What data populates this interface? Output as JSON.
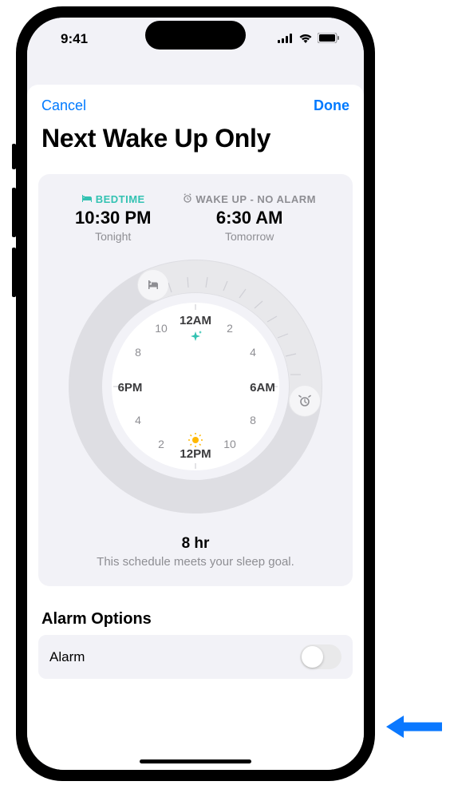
{
  "status": {
    "time": "9:41"
  },
  "nav": {
    "cancel": "Cancel",
    "done": "Done"
  },
  "title": "Next Wake Up Only",
  "bedtime": {
    "label": "BEDTIME",
    "time": "10:30 PM",
    "sub": "Tonight"
  },
  "wakeup": {
    "label": "WAKE UP - NO ALARM",
    "time": "6:30 AM",
    "sub": "Tomorrow"
  },
  "duration": {
    "value": "8 hr",
    "sub": "This schedule meets your sleep goal."
  },
  "alarm_section": {
    "title": "Alarm Options",
    "row_label": "Alarm",
    "enabled": false
  },
  "clock": {
    "labels": [
      "12AM",
      "2",
      "4",
      "6AM",
      "8",
      "10",
      "12PM",
      "2",
      "4",
      "6PM",
      "8",
      "10"
    ]
  }
}
